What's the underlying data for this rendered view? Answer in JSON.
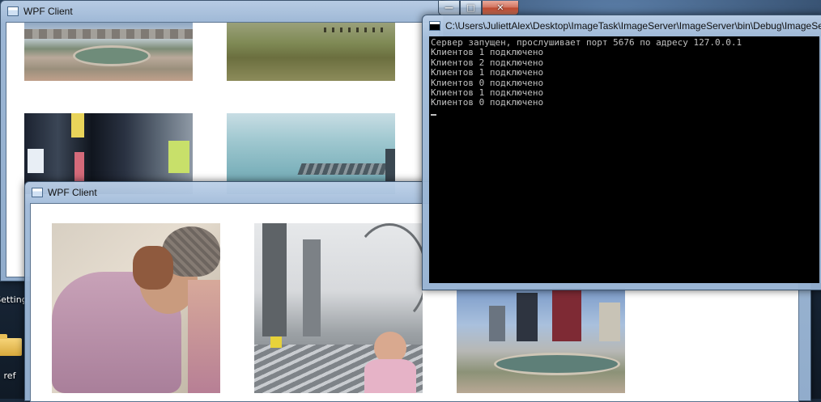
{
  "desktop": {
    "icons": [
      {
        "label": "Setting"
      },
      {
        "label": "ref"
      }
    ]
  },
  "back_window": {
    "title": "WPF Client",
    "caption": {
      "minimize": "—",
      "maximize": "□",
      "close": "✕"
    }
  },
  "front_window": {
    "title": "WPF Client"
  },
  "console_window": {
    "title": "C:\\Users\\JuliettAlex\\Desktop\\ImageTask\\ImageServer\\ImageServer\\bin\\Debug\\ImageServer.exe",
    "caption": {
      "minimize": "—",
      "maximize": "□",
      "close": "✕"
    },
    "lines": [
      "Сервер запущен, прослушивает порт 5676 по адресу 127.0.0.1",
      "Клиентов 1 подключено",
      "Клиентов 2 подключено",
      "Клиентов 1 подключено",
      "Клиентов 0 подключено",
      "Клиентов 1 подключено",
      "Клиентов 0 подключено"
    ]
  },
  "colors": {
    "console_bg": "#000000",
    "console_fg": "#c0c0c0",
    "aero_frame": "#a8bfd9",
    "close_button": "#c8553d"
  }
}
